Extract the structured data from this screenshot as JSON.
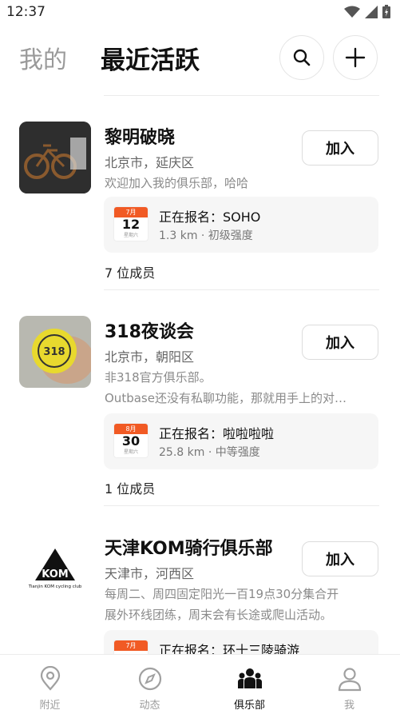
{
  "status_bar": {
    "time": "12:37"
  },
  "header": {
    "tab_mine": "我的",
    "tab_recent": "最近活跃",
    "search_icon": "search-icon",
    "add_icon": "plus-icon"
  },
  "clubs": [
    {
      "name": "黎明破晓",
      "location": "北京市，延庆区",
      "description": "欢迎加入我的俱乐部，哈哈",
      "join_label": "加入",
      "event": {
        "month": "7月",
        "day": "12",
        "weekday": "星期六",
        "title": "正在报名：SOHO",
        "meta": "1.3 km · 初级强度"
      },
      "members": "7 位成员"
    },
    {
      "name": "318夜谈会",
      "location": "北京市，朝阳区",
      "description_lines": [
        "非318官方俱乐部。",
        "Outbase还没有私聊功能，那就用手上的对…"
      ],
      "join_label": "加入",
      "avatar_text": "318",
      "event": {
        "month": "8月",
        "day": "30",
        "weekday": "星期六",
        "title": "正在报名：啦啦啦啦",
        "meta": "25.8 km · 中等强度"
      },
      "members": "1 位成员"
    },
    {
      "name": "天津KOM骑行俱乐部",
      "location": "天津市，河西区",
      "description_lines": [
        "每周二、周四固定阳光一百19点30分集合开",
        "展外环线团练，周末会有长途或爬山活动。"
      ],
      "join_label": "加入",
      "logo_text": "KOM",
      "logo_caption": "Tianjin KOM cycling club",
      "event": {
        "month": "7月",
        "title": "正在报名：环十三陵骑游"
      }
    }
  ],
  "bottom_nav": [
    {
      "label": "附近",
      "icon": "location-pin-icon",
      "active": false
    },
    {
      "label": "动态",
      "icon": "compass-icon",
      "active": false
    },
    {
      "label": "俱乐部",
      "icon": "group-icon",
      "active": true
    },
    {
      "label": "我",
      "icon": "person-icon",
      "active": false
    }
  ],
  "colors": {
    "accent": "#f15a24",
    "text": "#111111",
    "muted": "#9a9a9a"
  }
}
